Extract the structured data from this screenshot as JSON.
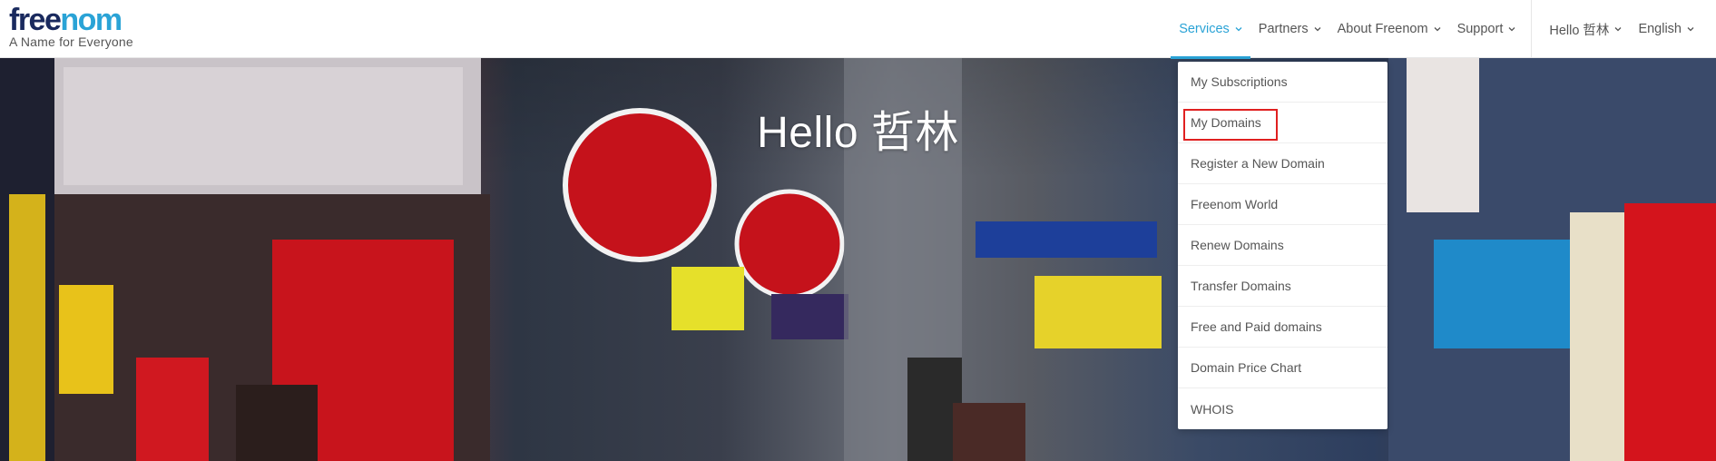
{
  "brand": {
    "name_part1": "free",
    "name_part2": "nom",
    "tagline": "A Name for Everyone",
    "primary_color": "#1a2a5e",
    "accent_color": "#2aa3d6"
  },
  "nav": {
    "items": [
      {
        "label": "Services",
        "active": true
      },
      {
        "label": "Partners",
        "active": false
      },
      {
        "label": "About Freenom",
        "active": false
      },
      {
        "label": "Support",
        "active": false
      }
    ],
    "user_menu": {
      "label": "Hello 哲林"
    },
    "language": {
      "label": "English"
    }
  },
  "hero": {
    "title": "Hello 哲林"
  },
  "services_menu": {
    "items": [
      {
        "label": "My Subscriptions"
      },
      {
        "label": "My Domains"
      },
      {
        "label": "Register a New Domain"
      },
      {
        "label": "Freenom World"
      },
      {
        "label": "Renew Domains"
      },
      {
        "label": "Transfer Domains"
      },
      {
        "label": "Free and Paid domains"
      },
      {
        "label": "Domain Price Chart"
      },
      {
        "label": "WHOIS"
      }
    ],
    "highlighted_item": "My Domains",
    "highlight_color": "#e02020"
  }
}
